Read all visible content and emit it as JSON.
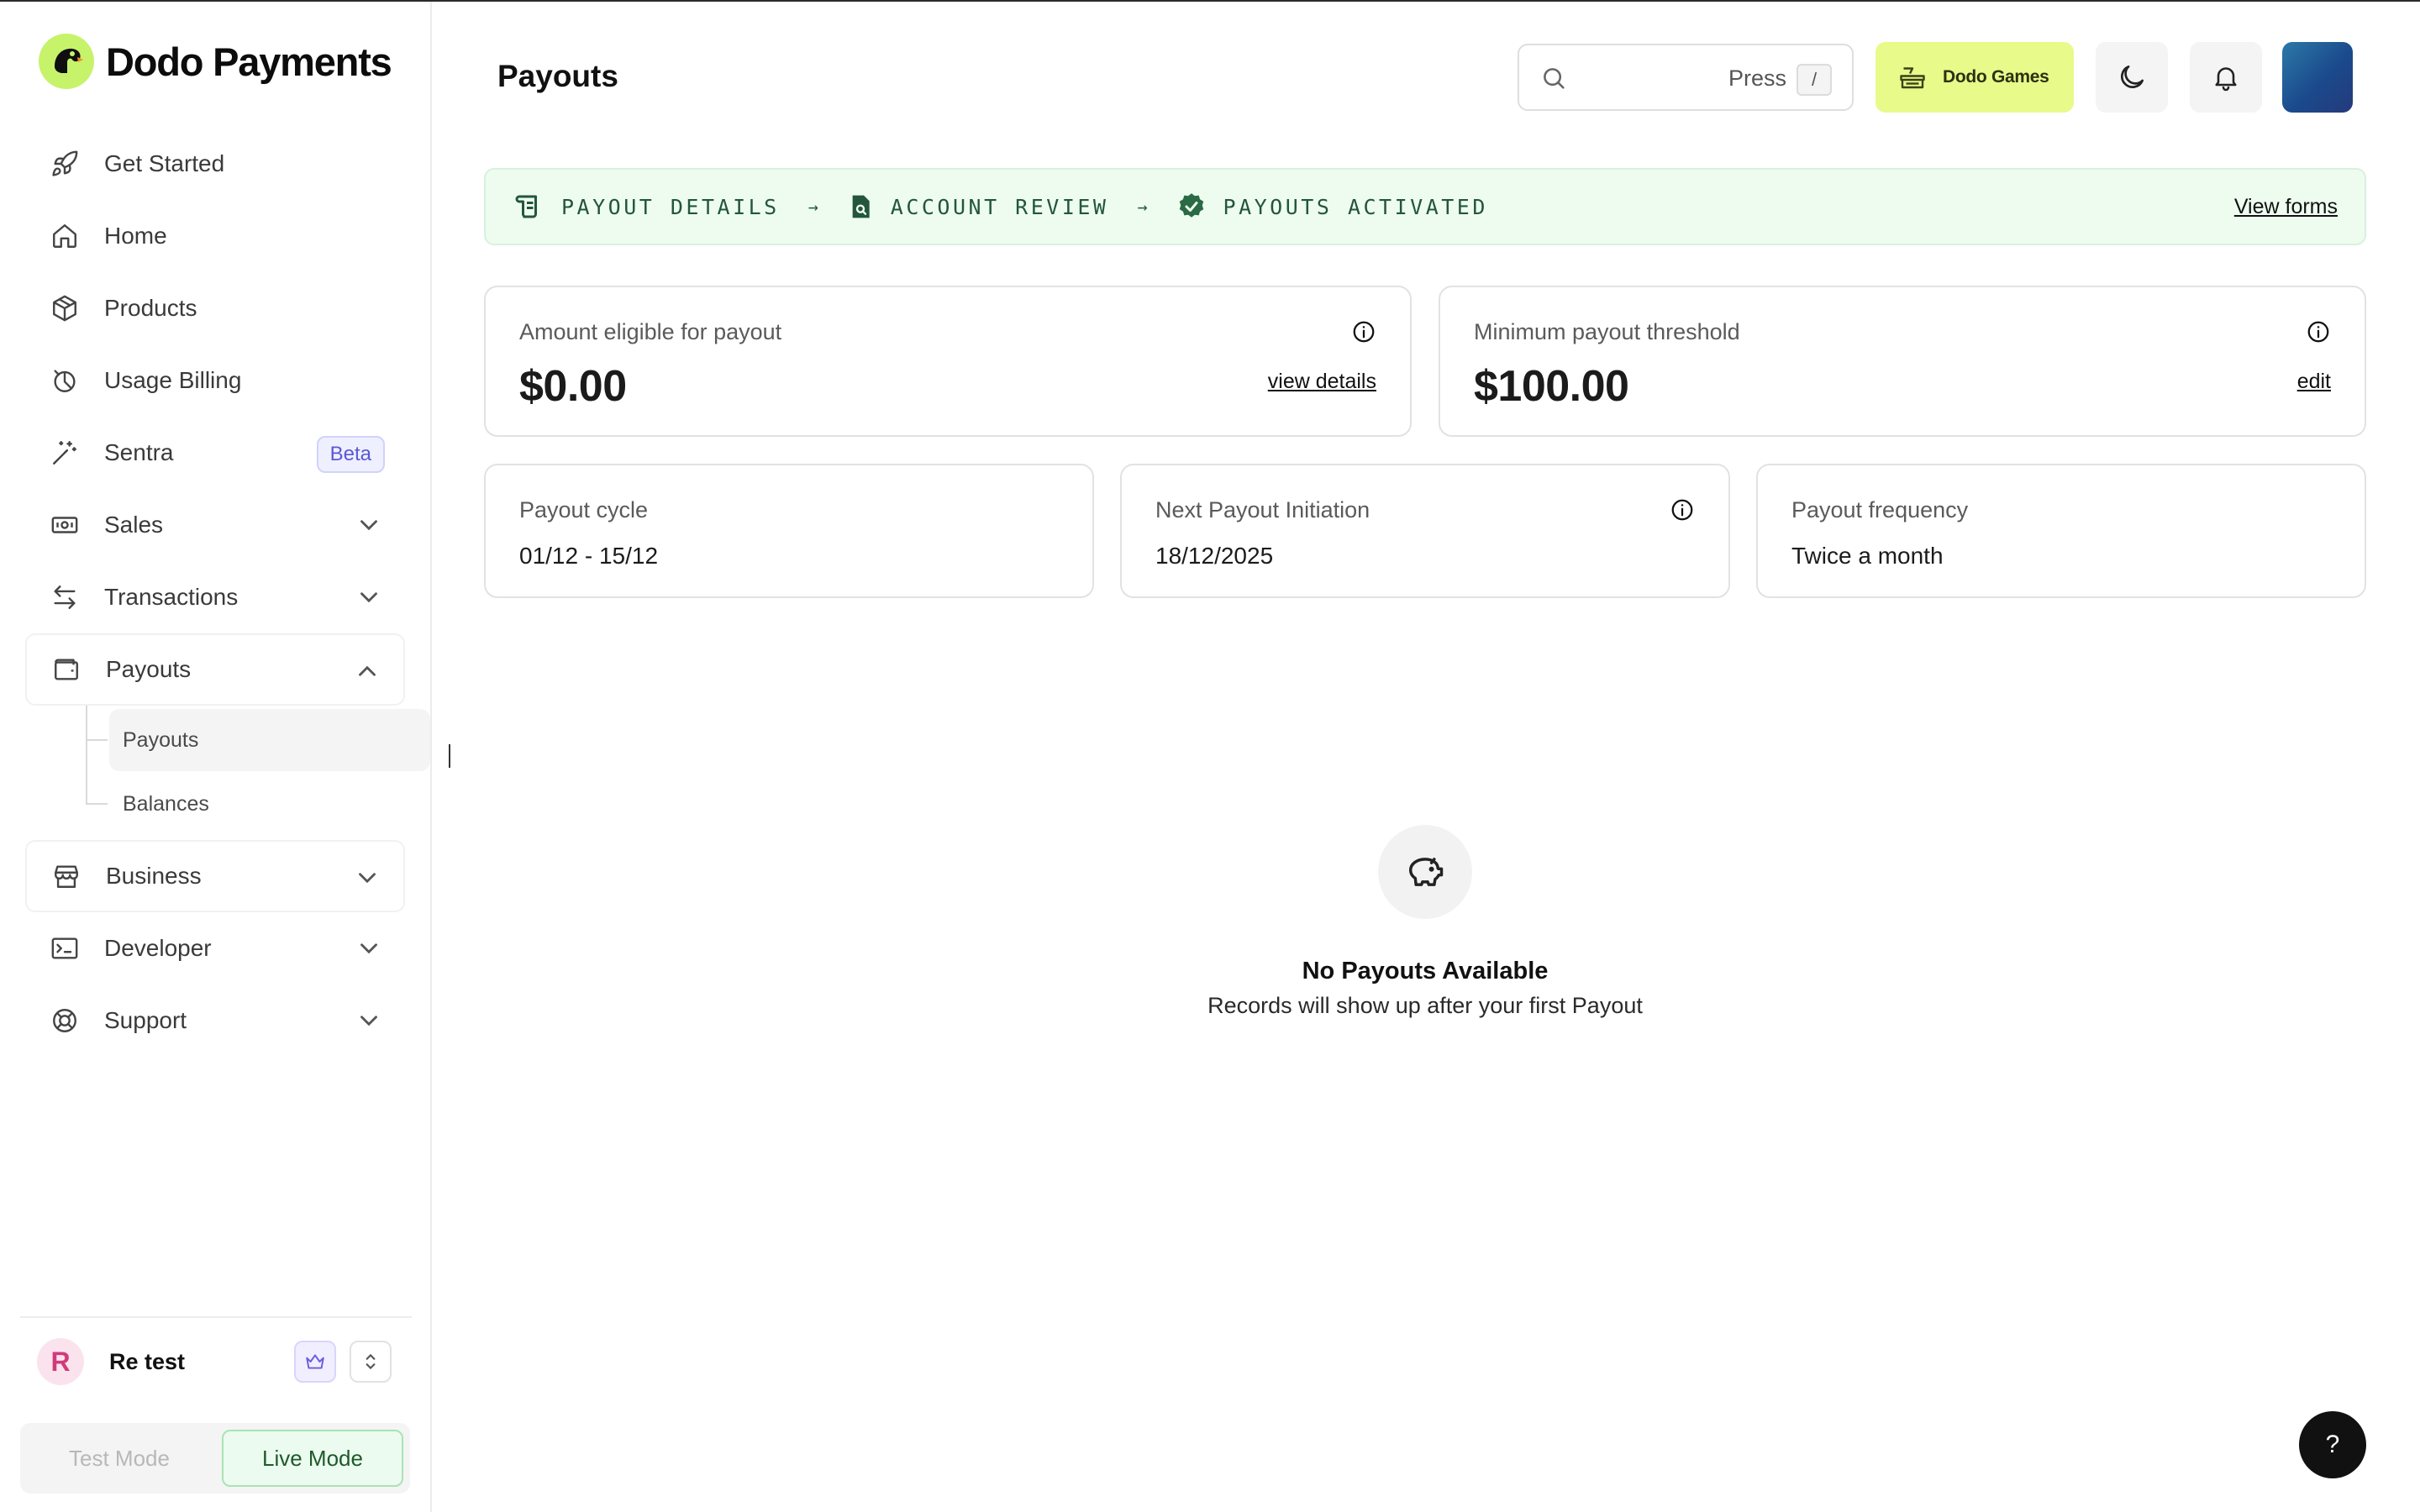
{
  "brand": {
    "name": "Dodo Payments",
    "accent": "#c6f36a"
  },
  "sidebar": {
    "items": [
      {
        "label": "Get Started",
        "icon": "rocket-icon"
      },
      {
        "label": "Home",
        "icon": "home-icon"
      },
      {
        "label": "Products",
        "icon": "package-icon"
      },
      {
        "label": "Usage Billing",
        "icon": "chart-icon"
      },
      {
        "label": "Sentra",
        "icon": "magic-wand-icon",
        "badge": "Beta"
      },
      {
        "label": "Sales",
        "icon": "banknote-icon",
        "expandable": true
      },
      {
        "label": "Transactions",
        "icon": "swap-icon",
        "expandable": true
      },
      {
        "label": "Payouts",
        "icon": "wallet-icon",
        "expanded": true
      },
      {
        "label": "Business",
        "icon": "store-icon",
        "expandable": true
      },
      {
        "label": "Developer",
        "icon": "terminal-icon",
        "expandable": true
      },
      {
        "label": "Support",
        "icon": "lifebuoy-icon",
        "expandable": true
      }
    ],
    "payouts_sub": [
      {
        "label": "Payouts",
        "active": true
      },
      {
        "label": "Balances"
      }
    ],
    "user": {
      "initial": "R",
      "name": "Re test"
    },
    "modes": {
      "test": "Test Mode",
      "live": "Live Mode",
      "selected": "Live Mode"
    }
  },
  "header": {
    "title": "Payouts",
    "search_hint": "Press",
    "search_key": "/",
    "business_button": "Dodo Games"
  },
  "banner": {
    "steps": [
      "PAYOUT DETAILS",
      "ACCOUNT REVIEW",
      "PAYOUTS ACTIVATED"
    ],
    "arrow": "→",
    "link": "View forms",
    "color": "#23563a"
  },
  "cards": {
    "eligible": {
      "label": "Amount eligible for payout",
      "value": "$0.00",
      "link": "view details"
    },
    "threshold": {
      "label": "Minimum payout threshold",
      "value": "$100.00",
      "link": "edit"
    },
    "cycle": {
      "label": "Payout cycle",
      "value": "01/12 - 15/12"
    },
    "next": {
      "label": "Next Payout Initiation",
      "value": "18/12/2025"
    },
    "frequency": {
      "label": "Payout frequency",
      "value": "Twice a month"
    }
  },
  "empty_state": {
    "title": "No Payouts Available",
    "subtitle": "Records will show up after your first Payout",
    "icon": "piggy-bank-icon"
  },
  "help_button": "?"
}
